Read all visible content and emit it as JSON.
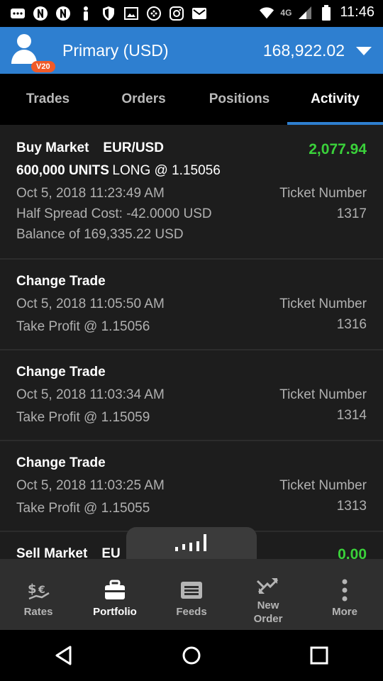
{
  "status_bar": {
    "network": "4G",
    "time": "11:46",
    "icons": [
      "notification-icon",
      "netflix-icon",
      "netflix-icon",
      "person-icon",
      "shield-icon",
      "image-icon",
      "gamepad-icon",
      "instagram-icon",
      "mail-icon",
      "wifi-icon",
      "signal-icon",
      "battery-icon"
    ]
  },
  "account": {
    "badge": "V20",
    "name": "Primary (USD)",
    "balance": "168,922.02"
  },
  "tabs": [
    {
      "label": "Trades",
      "active": false
    },
    {
      "label": "Orders",
      "active": false
    },
    {
      "label": "Positions",
      "active": false
    },
    {
      "label": "Activity",
      "active": true
    }
  ],
  "activity": {
    "row0": {
      "title": "Buy Market",
      "pair": "EUR/USD",
      "amount": "2,077.94",
      "units": "600,000 UNITS",
      "position": "LONG @ 1.15056",
      "date": "Oct 5, 2018 11:23:49 AM",
      "spread": "Half Spread Cost: -42.0000 USD",
      "balance": "Balance of 169,335.22 USD",
      "ticket_label": "Ticket Number",
      "ticket": "1317"
    },
    "row1": {
      "title": "Change Trade",
      "date": "Oct 5, 2018 11:05:50 AM",
      "detail": "Take Profit @ 1.15056",
      "ticket_label": "Ticket Number",
      "ticket": "1316"
    },
    "row2": {
      "title": "Change Trade",
      "date": "Oct 5, 2018 11:03:34 AM",
      "detail": "Take Profit @ 1.15059",
      "ticket_label": "Ticket Number",
      "ticket": "1314"
    },
    "row3": {
      "title": "Change Trade",
      "date": "Oct 5, 2018 11:03:25 AM",
      "detail": "Take Profit @ 1.15055",
      "ticket_label": "Ticket Number",
      "ticket": "1313"
    },
    "row4": {
      "title": "Sell Market",
      "pair": "EU",
      "amount": "0.00"
    }
  },
  "bottom_nav": {
    "rates": "Rates",
    "portfolio": "Portfolio",
    "feeds": "Feeds",
    "new_order": "New Order",
    "more": "More"
  },
  "colors": {
    "accent": "#2e7fd0",
    "positive": "#3ad13a",
    "badge": "#f05a28"
  }
}
